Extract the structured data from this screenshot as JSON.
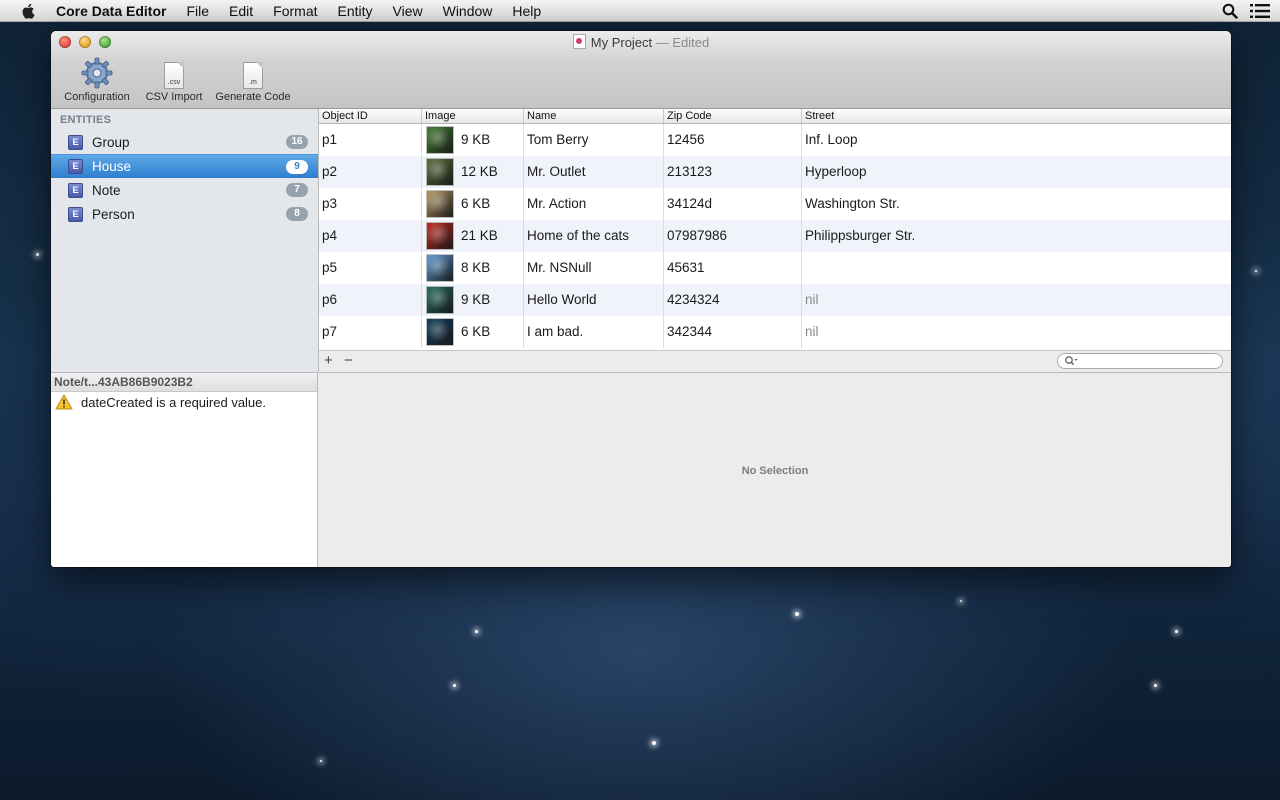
{
  "menubar": {
    "app_name": "Core Data Editor",
    "items": [
      "File",
      "Edit",
      "Format",
      "Entity",
      "View",
      "Window",
      "Help"
    ],
    "icons": [
      "apple-icon",
      "spotlight-search-icon",
      "notification-list-icon"
    ]
  },
  "window": {
    "title": "My Project",
    "title_suffix": " — Edited",
    "toolbar": {
      "configuration": "Configuration",
      "csv_import": "CSV Import",
      "csv_ext": ".csv",
      "generate_code": "Generate Code",
      "code_ext": ".m"
    }
  },
  "sidebar": {
    "header": "ENTITIES",
    "items": [
      {
        "icon": "E",
        "label": "Group",
        "count": "16"
      },
      {
        "icon": "E",
        "label": "House",
        "count": "9"
      },
      {
        "icon": "E",
        "label": "Note",
        "count": "7"
      },
      {
        "icon": "E",
        "label": "Person",
        "count": "8"
      }
    ],
    "selected": "House"
  },
  "table": {
    "columns": [
      "Object ID",
      "Image",
      "Name",
      "Zip Code",
      "Street"
    ],
    "rows": [
      {
        "id": "p1",
        "image_size": "9 KB",
        "name": "Tom Berry",
        "zip": "12456",
        "street": "Inf. Loop",
        "thumb_color": "#3f7d2e"
      },
      {
        "id": "p2",
        "image_size": "12 KB",
        "name": "Mr. Outlet",
        "zip": "213123",
        "street": "Hyperloop",
        "thumb_color": "#5a6f3a"
      },
      {
        "id": "p3",
        "image_size": "6 KB",
        "name": "Mr. Action",
        "zip": "34124d",
        "street": "Washington Str.",
        "thumb_color": "#b89a62"
      },
      {
        "id": "p4",
        "image_size": "21 KB",
        "name": "Home of the cats",
        "zip": "07987986",
        "street": "Philippsburger Str.",
        "thumb_color": "#c4261c"
      },
      {
        "id": "p5",
        "image_size": "8 KB",
        "name": "Mr. NSNull",
        "zip": "45631",
        "street": "",
        "thumb_color": "#5d9ad8"
      },
      {
        "id": "p6",
        "image_size": "9 KB",
        "name": "Hello World",
        "zip": "4234324",
        "street": "nil",
        "thumb_color": "#1f6b5c"
      },
      {
        "id": "p7",
        "image_size": "6 KB",
        "name": "I am bad.",
        "zip": "342344",
        "street": "nil",
        "thumb_color": "#0f3d5e"
      }
    ],
    "footer": {
      "add": "+",
      "remove": "−",
      "search_placeholder": ""
    }
  },
  "errors": {
    "header": "Note/t...43AB86B9023B2",
    "items": [
      {
        "icon": "warning-icon",
        "text": "dateCreated is a required value."
      }
    ]
  },
  "detail": {
    "empty_text": "No Selection"
  },
  "colors": {
    "selection": "#2f7dd0",
    "alt_row": "#f0f4fa",
    "sidebar": "#e3e7ec"
  }
}
